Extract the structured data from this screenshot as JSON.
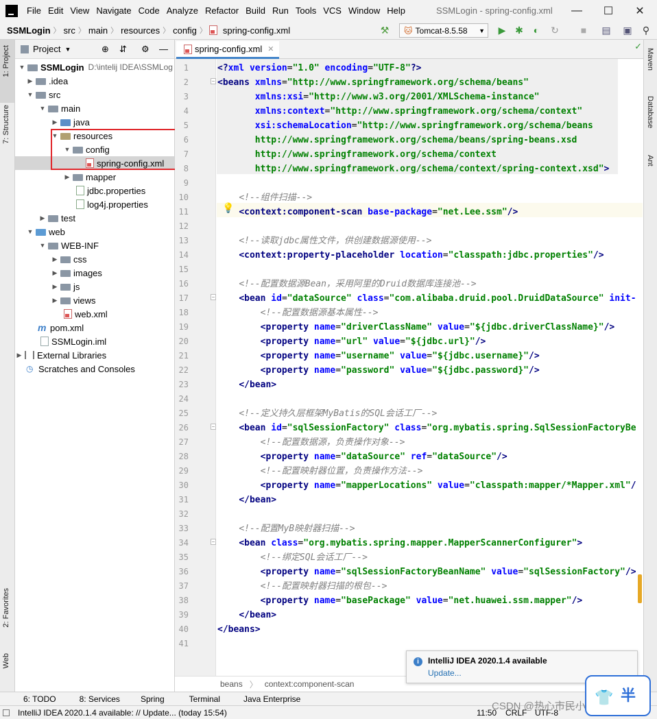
{
  "menubar": {
    "items": [
      "File",
      "Edit",
      "View",
      "Navigate",
      "Code",
      "Analyze",
      "Refactor",
      "Build",
      "Run",
      "Tools",
      "VCS",
      "Window",
      "Help"
    ],
    "title": "SSMLogin - spring-config.xml",
    "minimize": "—",
    "maximize": "☐",
    "close": "✕"
  },
  "navbar": {
    "crumbs": [
      "SSMLogin",
      "src",
      "main",
      "resources",
      "config",
      "spring-config.xml"
    ],
    "run_config": "Tomcat-8.5.58"
  },
  "left_strip": {
    "project": "1: Project",
    "structure": "7: Structure",
    "favorites": "2: Favorites",
    "web": "Web"
  },
  "project_panel": {
    "title": "Project",
    "tree": [
      {
        "label": "SSMLogin",
        "note": "D:\\intelij IDEA\\SSMLog"
      },
      {
        "label": ".idea"
      },
      {
        "label": "src"
      },
      {
        "label": "main"
      },
      {
        "label": "java"
      },
      {
        "label": "resources"
      },
      {
        "label": "config"
      },
      {
        "label": "spring-config.xml"
      },
      {
        "label": "mapper"
      },
      {
        "label": "jdbc.properties"
      },
      {
        "label": "log4j.properties"
      },
      {
        "label": "test"
      },
      {
        "label": "web"
      },
      {
        "label": "WEB-INF"
      },
      {
        "label": "css"
      },
      {
        "label": "images"
      },
      {
        "label": "js"
      },
      {
        "label": "views"
      },
      {
        "label": "web.xml"
      },
      {
        "label": "pom.xml"
      },
      {
        "label": "SSMLogin.iml"
      },
      {
        "label": "External Libraries"
      },
      {
        "label": "Scratches and Consoles"
      }
    ]
  },
  "editor": {
    "tab": "spring-config.xml",
    "breadcrumb": [
      "beans",
      "context:component-scan"
    ],
    "lines": [
      {
        "n": "1",
        "parts": [
          [
            "t",
            "<?"
          ],
          [
            "a",
            "xml "
          ],
          [
            "a",
            "version"
          ],
          [
            "p",
            "="
          ],
          [
            "v",
            "\"1.0\""
          ],
          [
            "a",
            " encoding"
          ],
          [
            "p",
            "="
          ],
          [
            "v",
            "\"UTF-8\""
          ],
          [
            "t",
            "?>"
          ]
        ]
      },
      {
        "n": "2",
        "parts": [
          [
            "t",
            "<beans "
          ],
          [
            "a",
            "xmlns"
          ],
          [
            "p",
            "="
          ],
          [
            "v",
            "\"http://www.springframework.org/schema/beans\""
          ]
        ]
      },
      {
        "n": "3",
        "parts": [
          [
            "p",
            "       "
          ],
          [
            "a",
            "xmlns:xsi"
          ],
          [
            "p",
            "="
          ],
          [
            "v",
            "\"http://www.w3.org/2001/XMLSchema-instance\""
          ]
        ]
      },
      {
        "n": "4",
        "parts": [
          [
            "p",
            "       "
          ],
          [
            "a",
            "xmlns:context"
          ],
          [
            "p",
            "="
          ],
          [
            "v",
            "\"http://www.springframework.org/schema/context\""
          ]
        ]
      },
      {
        "n": "5",
        "parts": [
          [
            "p",
            "       "
          ],
          [
            "a",
            "xsi:schemaLocation"
          ],
          [
            "p",
            "="
          ],
          [
            "v",
            "\"http://www.springframework.org/schema/beans"
          ]
        ]
      },
      {
        "n": "6",
        "parts": [
          [
            "v",
            "       http://www.springframework.org/schema/beans/spring-beans.xsd"
          ]
        ]
      },
      {
        "n": "7",
        "parts": [
          [
            "v",
            "       http://www.springframework.org/schema/context"
          ]
        ]
      },
      {
        "n": "8",
        "parts": [
          [
            "v",
            "       http://www.springframework.org/schema/context/spring-context.xsd\""
          ],
          [
            "t",
            ">"
          ]
        ]
      },
      {
        "n": "9",
        "parts": []
      },
      {
        "n": "10",
        "parts": [
          [
            "p",
            "    "
          ],
          [
            "c",
            "<!--组件扫描-->"
          ]
        ]
      },
      {
        "n": "11",
        "parts": [
          [
            "p",
            "    "
          ],
          [
            "t",
            "<context:component-scan "
          ],
          [
            "a",
            "base-package"
          ],
          [
            "p",
            "="
          ],
          [
            "v",
            "\"net.Lee.ssm\""
          ],
          [
            "t",
            "/>"
          ]
        ]
      },
      {
        "n": "12",
        "parts": []
      },
      {
        "n": "13",
        "parts": [
          [
            "p",
            "    "
          ],
          [
            "c",
            "<!--读取jdbc属性文件，供创建数据源使用-->"
          ]
        ]
      },
      {
        "n": "14",
        "parts": [
          [
            "p",
            "    "
          ],
          [
            "t",
            "<context:property-placeholder "
          ],
          [
            "a",
            "location"
          ],
          [
            "p",
            "="
          ],
          [
            "v",
            "\"classpath:jdbc.properties\""
          ],
          [
            "t",
            "/>"
          ]
        ]
      },
      {
        "n": "15",
        "parts": []
      },
      {
        "n": "16",
        "parts": [
          [
            "p",
            "    "
          ],
          [
            "c",
            "<!--配置数据源Bean，采用阿里的Druid数据库连接池-->"
          ]
        ]
      },
      {
        "n": "17",
        "parts": [
          [
            "p",
            "    "
          ],
          [
            "t",
            "<bean "
          ],
          [
            "a",
            "id"
          ],
          [
            "p",
            "="
          ],
          [
            "v",
            "\"dataSource\""
          ],
          [
            "a",
            " class"
          ],
          [
            "p",
            "="
          ],
          [
            "v",
            "\"com.alibaba.druid.pool.DruidDataSource\""
          ],
          [
            "a",
            " init-"
          ]
        ]
      },
      {
        "n": "18",
        "parts": [
          [
            "p",
            "        "
          ],
          [
            "c",
            "<!--配置数据源基本属性-->"
          ]
        ]
      },
      {
        "n": "19",
        "parts": [
          [
            "p",
            "        "
          ],
          [
            "t",
            "<property "
          ],
          [
            "a",
            "name"
          ],
          [
            "p",
            "="
          ],
          [
            "v",
            "\"driverClassName\""
          ],
          [
            "a",
            " value"
          ],
          [
            "p",
            "="
          ],
          [
            "v",
            "\"${jdbc.driverClassName}\""
          ],
          [
            "t",
            "/>"
          ]
        ]
      },
      {
        "n": "20",
        "parts": [
          [
            "p",
            "        "
          ],
          [
            "t",
            "<property "
          ],
          [
            "a",
            "name"
          ],
          [
            "p",
            "="
          ],
          [
            "v",
            "\"url\""
          ],
          [
            "a",
            " value"
          ],
          [
            "p",
            "="
          ],
          [
            "v",
            "\"${jdbc.url}\""
          ],
          [
            "t",
            "/>"
          ]
        ]
      },
      {
        "n": "21",
        "parts": [
          [
            "p",
            "        "
          ],
          [
            "t",
            "<property "
          ],
          [
            "a",
            "name"
          ],
          [
            "p",
            "="
          ],
          [
            "v",
            "\"username\""
          ],
          [
            "a",
            " value"
          ],
          [
            "p",
            "="
          ],
          [
            "v",
            "\"${jdbc.username}\""
          ],
          [
            "t",
            "/>"
          ]
        ]
      },
      {
        "n": "22",
        "parts": [
          [
            "p",
            "        "
          ],
          [
            "t",
            "<property "
          ],
          [
            "a",
            "name"
          ],
          [
            "p",
            "="
          ],
          [
            "v",
            "\"password\""
          ],
          [
            "a",
            " value"
          ],
          [
            "p",
            "="
          ],
          [
            "v",
            "\"${jdbc.password}\""
          ],
          [
            "t",
            "/>"
          ]
        ]
      },
      {
        "n": "23",
        "parts": [
          [
            "p",
            "    "
          ],
          [
            "t",
            "</bean>"
          ]
        ]
      },
      {
        "n": "24",
        "parts": []
      },
      {
        "n": "25",
        "parts": [
          [
            "p",
            "    "
          ],
          [
            "c",
            "<!--定义持久层框架MyBatis的SQL会话工厂-->"
          ]
        ]
      },
      {
        "n": "26",
        "parts": [
          [
            "p",
            "    "
          ],
          [
            "t",
            "<bean "
          ],
          [
            "a",
            "id"
          ],
          [
            "p",
            "="
          ],
          [
            "v",
            "\"sqlSessionFactory\""
          ],
          [
            "a",
            " class"
          ],
          [
            "p",
            "="
          ],
          [
            "v",
            "\"org.mybatis.spring.SqlSessionFactoryBe"
          ]
        ]
      },
      {
        "n": "27",
        "parts": [
          [
            "p",
            "        "
          ],
          [
            "c",
            "<!--配置数据源，负责操作对象-->"
          ]
        ]
      },
      {
        "n": "28",
        "parts": [
          [
            "p",
            "        "
          ],
          [
            "t",
            "<property "
          ],
          [
            "a",
            "name"
          ],
          [
            "p",
            "="
          ],
          [
            "v",
            "\"dataSource\""
          ],
          [
            "a",
            " ref"
          ],
          [
            "p",
            "="
          ],
          [
            "v",
            "\"dataSource\""
          ],
          [
            "t",
            "/>"
          ]
        ]
      },
      {
        "n": "29",
        "parts": [
          [
            "p",
            "        "
          ],
          [
            "c",
            "<!--配置映射器位置，负责操作方法-->"
          ]
        ]
      },
      {
        "n": "30",
        "parts": [
          [
            "p",
            "        "
          ],
          [
            "t",
            "<property "
          ],
          [
            "a",
            "name"
          ],
          [
            "p",
            "="
          ],
          [
            "v",
            "\"mapperLocations\""
          ],
          [
            "a",
            " value"
          ],
          [
            "p",
            "="
          ],
          [
            "v",
            "\"classpath:mapper/*Mapper.xml\""
          ],
          [
            "t",
            "/"
          ]
        ]
      },
      {
        "n": "31",
        "parts": [
          [
            "p",
            "    "
          ],
          [
            "t",
            "</bean>"
          ]
        ]
      },
      {
        "n": "32",
        "parts": []
      },
      {
        "n": "33",
        "parts": [
          [
            "p",
            "    "
          ],
          [
            "c",
            "<!--配置MyB映射器扫描-->"
          ]
        ]
      },
      {
        "n": "34",
        "parts": [
          [
            "p",
            "    "
          ],
          [
            "t",
            "<bean "
          ],
          [
            "a",
            "class"
          ],
          [
            "p",
            "="
          ],
          [
            "v",
            "\"org.mybatis.spring.mapper.MapperScannerConfigurer\""
          ],
          [
            "t",
            ">"
          ]
        ]
      },
      {
        "n": "35",
        "parts": [
          [
            "p",
            "        "
          ],
          [
            "c",
            "<!--绑定SQL会话工厂-->"
          ]
        ]
      },
      {
        "n": "36",
        "parts": [
          [
            "p",
            "        "
          ],
          [
            "t",
            "<property "
          ],
          [
            "a",
            "name"
          ],
          [
            "p",
            "="
          ],
          [
            "v",
            "\"sqlSessionFactoryBeanName\""
          ],
          [
            "a",
            " value"
          ],
          [
            "p",
            "="
          ],
          [
            "v",
            "\"sqlSessionFactory\""
          ],
          [
            "t",
            "/>"
          ]
        ]
      },
      {
        "n": "37",
        "parts": [
          [
            "p",
            "        "
          ],
          [
            "c",
            "<!--配置映射器扫描的根包-->"
          ]
        ]
      },
      {
        "n": "38",
        "parts": [
          [
            "p",
            "        "
          ],
          [
            "t",
            "<property "
          ],
          [
            "a",
            "name"
          ],
          [
            "p",
            "="
          ],
          [
            "v",
            "\"basePackage\""
          ],
          [
            "a",
            " value"
          ],
          [
            "p",
            "="
          ],
          [
            "v",
            "\"net.huawei.ssm.mapper\""
          ],
          [
            "t",
            "/>"
          ]
        ]
      },
      {
        "n": "39",
        "parts": [
          [
            "p",
            "    "
          ],
          [
            "t",
            "</bean>"
          ]
        ]
      },
      {
        "n": "40",
        "parts": [
          [
            "t",
            "</beans>"
          ]
        ]
      },
      {
        "n": "41",
        "parts": []
      }
    ]
  },
  "right_strip": {
    "maven": "Maven",
    "database": "Database",
    "ant": "Ant"
  },
  "bottom_tools": [
    "6: TODO",
    "8: Services",
    "Spring",
    "Terminal",
    "Java Enterprise"
  ],
  "status": {
    "message": "IntelliJ IDEA 2020.1.4 available: // Update... (today 15:54)",
    "time": "11:50",
    "line_sep": "CRLF",
    "encoding": "UTF-8"
  },
  "notification": {
    "title": "IntelliJ IDEA 2020.1.4 available",
    "link": "Update..."
  },
  "watermark": "CSDN @热心市民小黄同学",
  "avatar_char": "半",
  "colors": {
    "selection_box": "#e0252a",
    "tab_underline": "#4083c9"
  }
}
